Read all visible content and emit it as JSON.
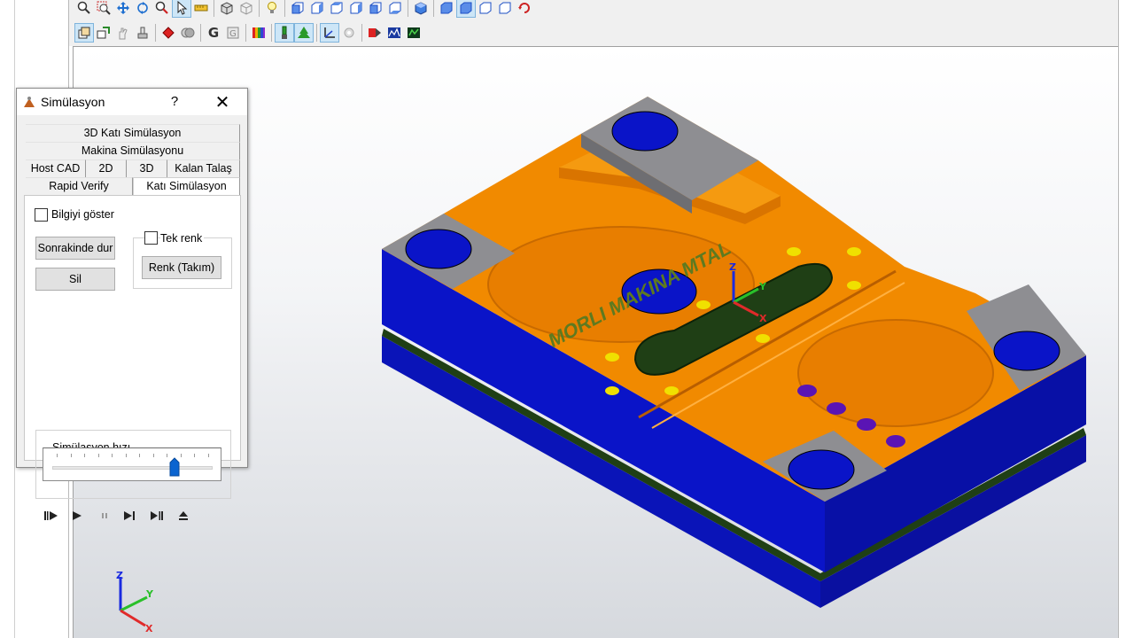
{
  "toolbar": {
    "row1_icons": [
      "zoom-icon",
      "zoom-window-icon",
      "pan-icon",
      "rotate-icon",
      "zoom-fit-icon",
      "select-arrow-icon",
      "ruler-icon",
      "box-solid-icon",
      "box-wire-icon",
      "light-icon",
      "view-front-icon",
      "view-back-icon",
      "view-left-icon",
      "view-right-icon",
      "view-top-icon",
      "view-bottom-icon",
      "shaded-cube-icon",
      "view-iso-1-icon",
      "view-iso-2-icon",
      "view-iso-3-icon",
      "view-iso-4-icon",
      "view-refresh-icon"
    ],
    "row2_icons": [
      "layer-box-icon",
      "export-icon",
      "hand-icon",
      "stamp-icon",
      "record-icon",
      "filter-icon",
      "gcode-g-icon",
      "gcode-settings-icon",
      "color-palette-icon",
      "tool-icon",
      "tree-icon",
      "axis-icon",
      "options-icon",
      "simulate-red-icon",
      "simulate-blue-icon",
      "simulate-green-icon"
    ],
    "gcode_letter": "G"
  },
  "dialog": {
    "title": "Simülasyon",
    "help": "?",
    "close": "✕",
    "tabs_row1": [
      "3D Katı Simülasyon"
    ],
    "tabs_row2": [
      "Makina Simülasyonu"
    ],
    "tabs_row3": [
      "Host CAD",
      "2D",
      "3D",
      "Kalan Talaş"
    ],
    "tabs_row4": [
      "Rapid Verify",
      "Katı Simülasyon"
    ],
    "checkbox_info": "Bilgiyi göster",
    "btn_stop_next": "Sonrakinde dur",
    "btn_delete": "Sil",
    "checkbox_single_color": "Tek renk",
    "btn_color_tool": "Renk (Takım)",
    "speed_label": "Simülasyon hızı",
    "speed_level": 0.76,
    "player_buttons": [
      "step-start-icon",
      "play-icon",
      "pause-icon",
      "step-forward-icon",
      "step-end-icon",
      "eject-icon"
    ]
  },
  "model": {
    "engraving_text": "MORLI MAKINA MTAL",
    "axis_x": "X",
    "axis_y": "Y",
    "axis_z": "Z",
    "colors": {
      "orange": "#F18A00",
      "blue": "#0A14C8",
      "gray": "#8E8E92",
      "yellow": "#F0E000",
      "purple": "#5A14B4",
      "dark": "#1F3F15"
    }
  },
  "triad": {
    "x": "X",
    "y": "Y",
    "z": "Z"
  }
}
